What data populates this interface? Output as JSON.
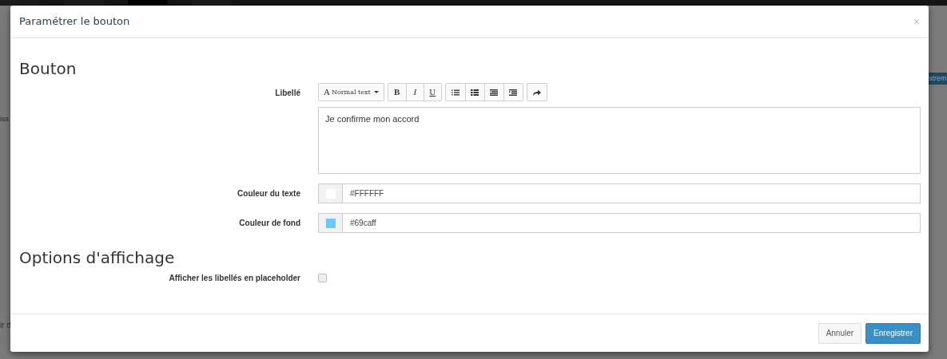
{
  "backdrop": {
    "nav": [
      {
        "selected": false
      },
      {
        "selected": false
      },
      {
        "selected": true
      },
      {
        "selected": false
      }
    ],
    "left_texts": [
      "iss",
      "ir d"
    ],
    "right_button": "strem"
  },
  "dialog": {
    "title": "Paramétrer le bouton",
    "close": "×",
    "sections": [
      {
        "heading": "Bouton",
        "fields": [
          {
            "kind": "editor",
            "label": "Libellé",
            "value": "Je confirme mon accord",
            "toolbar": [
              [
                {
                  "kind": "style",
                  "glyph": "A",
                  "label": "Normal text"
                }
              ],
              [
                {
                  "kind": "bold",
                  "label": "B"
                },
                {
                  "kind": "italic",
                  "label": "I"
                },
                {
                  "kind": "underline",
                  "label": "U"
                }
              ],
              [
                {
                  "kind": "bullets"
                },
                {
                  "kind": "numbers"
                },
                {
                  "kind": "outdent"
                },
                {
                  "kind": "indent"
                }
              ],
              [
                {
                  "kind": "redo"
                }
              ]
            ]
          },
          {
            "kind": "color",
            "label": "Couleur du texte",
            "value": "#FFFFFF",
            "color": "#ffffff"
          },
          {
            "kind": "color",
            "label": "Couleur de fond",
            "value": "#69caff",
            "color": "#69caff"
          }
        ]
      },
      {
        "heading": "Options d'affichage",
        "fields": [
          {
            "kind": "checkbox",
            "label": "Afficher les libellés en placeholder",
            "checked": false
          }
        ]
      }
    ],
    "buttons": [
      {
        "kind": "cancel",
        "label": "Annuler"
      },
      {
        "kind": "primary",
        "label": "Enregistrer"
      }
    ]
  }
}
